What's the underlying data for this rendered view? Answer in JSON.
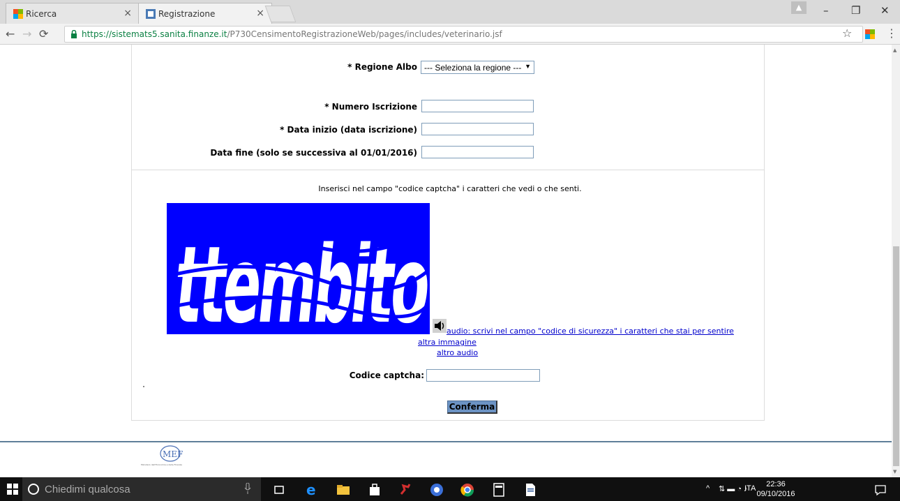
{
  "browser": {
    "tabs": [
      {
        "label": "Ricerca"
      },
      {
        "label": "Registrazione"
      }
    ],
    "url_host": "https://sistemats5.sanita.finanze.it",
    "url_path": "/P730CensimentoRegistrazioneWeb/pages/includes/veterinario.jsf",
    "window_controls": {
      "minimize": "–",
      "restore": "❐",
      "close": "✕"
    }
  },
  "form": {
    "regione_label": "* Regione Albo",
    "regione_selected": "--- Seleziona la regione ---",
    "numero_label": "* Numero Iscrizione",
    "numero_value": "",
    "data_inizio_label": "* Data inizio (data iscrizione)",
    "data_inizio_value": "",
    "data_fine_label": "Data fine (solo se successiva al 01/01/2016)",
    "data_fine_value": ""
  },
  "captcha": {
    "instruction": "Inserisci nel campo \"codice captcha\" i caratteri che vedi o che senti.",
    "image_text": "ttembito",
    "audio_link": "audio: scrivi nel campo \"codice di sicurezza\" i caratteri che stai per sentire",
    "other_image_link": "altra immagine",
    "other_audio_link": "altro audio",
    "code_label": "Codice captcha:",
    "code_value": "",
    "confirm_label": "Conferma"
  },
  "footer": {
    "logo_text": "MEF",
    "logo_caption": "Ministero dell'Economia e delle Finanze"
  },
  "taskbar": {
    "search_placeholder": "Chiedimi qualcosa",
    "language": "ITA",
    "time": "22:36",
    "date": "09/10/2016"
  },
  "colors": {
    "captcha_bg": "#0000ff",
    "link": "#0000cc",
    "confirm_button": "#6c93c4",
    "footer_line": "#5f7f99"
  }
}
